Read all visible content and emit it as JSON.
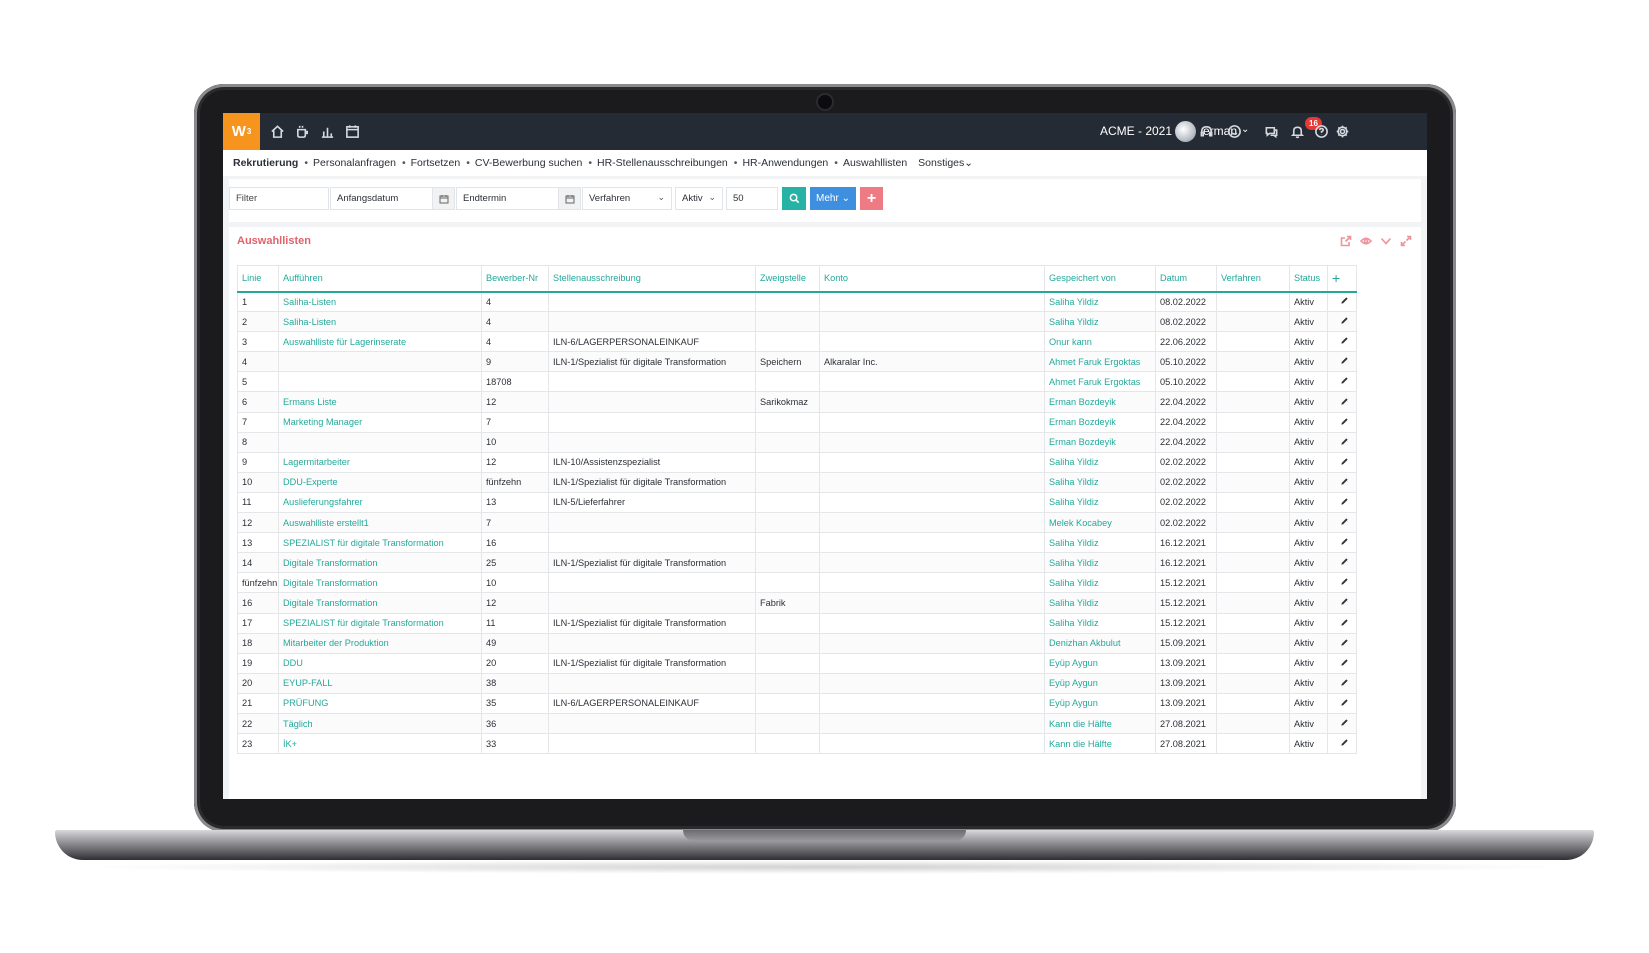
{
  "app": {
    "logo_text": "W",
    "logo_sup": "3",
    "company": "ACME - 2021",
    "username": "erman",
    "notification_count": "16",
    "brand_color": "#f7941d",
    "accent_color": "#23a99a"
  },
  "nav": {
    "items": [
      {
        "label": "Rekrutierung",
        "active": true
      },
      {
        "label": "Personalanfragen"
      },
      {
        "label": "Fortsetzen"
      },
      {
        "label": "CV-Bewerbung suchen"
      },
      {
        "label": "HR-Stellenausschreibungen"
      },
      {
        "label": "HR-Anwendungen"
      },
      {
        "label": "Auswahllisten"
      }
    ],
    "more_label": "Sonstiges"
  },
  "filters": {
    "filter_placeholder": "Filter",
    "start_date_placeholder": "Anfangsdatum",
    "end_date_placeholder": "Endtermin",
    "procedure_value": "Verfahren",
    "status_value": "Aktiv",
    "page_size_value": "50",
    "more_label": "Mehr"
  },
  "panel": {
    "title": "Auswahllisten"
  },
  "table": {
    "headers": [
      "Linie",
      "Aufführen",
      "Bewerber-Nr",
      "Stellenausschreibung",
      "Zweigstelle",
      "Konto",
      "Gespeichert von",
      "Datum",
      "Verfahren",
      "Status"
    ],
    "rows": [
      {
        "linie": "1",
        "name": "Saliha-Listen",
        "nr": "4",
        "stelle": "",
        "zweig": "",
        "konto": "",
        "von": "Saliha Yildiz",
        "datum": "08.02.2022",
        "verfahren": "",
        "status": "Aktiv"
      },
      {
        "linie": "2",
        "name": "Saliha-Listen",
        "nr": "4",
        "stelle": "",
        "zweig": "",
        "konto": "",
        "von": "Saliha Yildiz",
        "datum": "08.02.2022",
        "verfahren": "",
        "status": "Aktiv"
      },
      {
        "linie": "3",
        "name": "Auswahlliste für Lagerinserate",
        "nr": "4",
        "stelle": "ILN-6/LAGERPERSONALEINKAUF",
        "zweig": "",
        "konto": "",
        "von": "Onur kann",
        "datum": "22.06.2022",
        "verfahren": "",
        "status": "Aktiv"
      },
      {
        "linie": "4",
        "name": "",
        "nr": "9",
        "stelle": "ILN-1/Spezialist für digitale Transformation",
        "zweig": "Speichern",
        "konto": "Alkaralar Inc.",
        "von": "Ahmet Faruk Ergoktas",
        "datum": "05.10.2022",
        "verfahren": "",
        "status": "Aktiv"
      },
      {
        "linie": "5",
        "name": "",
        "nr": "18708",
        "stelle": "",
        "zweig": "",
        "konto": "",
        "von": "Ahmet Faruk Ergoktas",
        "datum": "05.10.2022",
        "verfahren": "",
        "status": "Aktiv"
      },
      {
        "linie": "6",
        "name": "Ermans Liste",
        "nr": "12",
        "stelle": "",
        "zweig": "Sarikokmaz",
        "konto": "",
        "von": "Erman Bozdeyik",
        "datum": "22.04.2022",
        "verfahren": "",
        "status": "Aktiv"
      },
      {
        "linie": "7",
        "name": "Marketing Manager",
        "nr": "7",
        "stelle": "",
        "zweig": "",
        "konto": "",
        "von": "Erman Bozdeyik",
        "datum": "22.04.2022",
        "verfahren": "",
        "status": "Aktiv"
      },
      {
        "linie": "8",
        "name": "",
        "nr": "10",
        "stelle": "",
        "zweig": "",
        "konto": "",
        "von": "Erman Bozdeyik",
        "datum": "22.04.2022",
        "verfahren": "",
        "status": "Aktiv"
      },
      {
        "linie": "9",
        "name": "Lagermitarbeiter",
        "nr": "12",
        "stelle": "ILN-10/Assistenzspezialist",
        "zweig": "",
        "konto": "",
        "von": "Saliha Yildiz",
        "datum": "02.02.2022",
        "verfahren": "",
        "status": "Aktiv"
      },
      {
        "linie": "10",
        "name": "DDU-Experte",
        "nr": "fünfzehn",
        "stelle": "ILN-1/Spezialist für digitale Transformation",
        "zweig": "",
        "konto": "",
        "von": "Saliha Yildiz",
        "datum": "02.02.2022",
        "verfahren": "",
        "status": "Aktiv"
      },
      {
        "linie": "11",
        "name": "Auslieferungsfahrer",
        "nr": "13",
        "stelle": "ILN-5/Lieferfahrer",
        "zweig": "",
        "konto": "",
        "von": "Saliha Yildiz",
        "datum": "02.02.2022",
        "verfahren": "",
        "status": "Aktiv"
      },
      {
        "linie": "12",
        "name": "Auswahlliste erstellt1",
        "nr": "7",
        "stelle": "",
        "zweig": "",
        "konto": "",
        "von": "Melek Kocabey",
        "datum": "02.02.2022",
        "verfahren": "",
        "status": "Aktiv"
      },
      {
        "linie": "13",
        "name": "SPEZIALIST für digitale Transformation",
        "nr": "16",
        "stelle": "",
        "zweig": "",
        "konto": "",
        "von": "Saliha Yildiz",
        "datum": "16.12.2021",
        "verfahren": "",
        "status": "Aktiv"
      },
      {
        "linie": "14",
        "name": "Digitale Transformation",
        "nr": "25",
        "stelle": "ILN-1/Spezialist für digitale Transformation",
        "zweig": "",
        "konto": "",
        "von": "Saliha Yildiz",
        "datum": "16.12.2021",
        "verfahren": "",
        "status": "Aktiv"
      },
      {
        "linie": "fünfzehn",
        "name": "Digitale Transformation",
        "nr": "10",
        "stelle": "",
        "zweig": "",
        "konto": "",
        "von": "Saliha Yildiz",
        "datum": "15.12.2021",
        "verfahren": "",
        "status": "Aktiv"
      },
      {
        "linie": "16",
        "name": "Digitale Transformation",
        "nr": "12",
        "stelle": "",
        "zweig": "Fabrik",
        "konto": "",
        "von": "Saliha Yildiz",
        "datum": "15.12.2021",
        "verfahren": "",
        "status": "Aktiv"
      },
      {
        "linie": "17",
        "name": "SPEZIALIST für digitale Transformation",
        "nr": "11",
        "stelle": "ILN-1/Spezialist für digitale Transformation",
        "zweig": "",
        "konto": "",
        "von": "Saliha Yildiz",
        "datum": "15.12.2021",
        "verfahren": "",
        "status": "Aktiv"
      },
      {
        "linie": "18",
        "name": "Mitarbeiter der Produktion",
        "nr": "49",
        "stelle": "",
        "zweig": "",
        "konto": "",
        "von": "Denizhan Akbulut",
        "datum": "15.09.2021",
        "verfahren": "",
        "status": "Aktiv"
      },
      {
        "linie": "19",
        "name": "DDU",
        "nr": "20",
        "stelle": "ILN-1/Spezialist für digitale Transformation",
        "zweig": "",
        "konto": "",
        "von": "Eyüp Aygun",
        "datum": "13.09.2021",
        "verfahren": "",
        "status": "Aktiv"
      },
      {
        "linie": "20",
        "name": "EYUP-FALL",
        "nr": "38",
        "stelle": "",
        "zweig": "",
        "konto": "",
        "von": "Eyüp Aygun",
        "datum": "13.09.2021",
        "verfahren": "",
        "status": "Aktiv"
      },
      {
        "linie": "21",
        "name": "PRÜFUNG",
        "nr": "35",
        "stelle": "ILN-6/LAGERPERSONALEINKAUF",
        "zweig": "",
        "konto": "",
        "von": "Eyüp Aygun",
        "datum": "13.09.2021",
        "verfahren": "",
        "status": "Aktiv"
      },
      {
        "linie": "22",
        "name": "Täglich",
        "nr": "36",
        "stelle": "",
        "zweig": "",
        "konto": "",
        "von": "Kann die Hälfte",
        "datum": "27.08.2021",
        "verfahren": "",
        "status": "Aktiv"
      },
      {
        "linie": "23",
        "name": "İK+",
        "nr": "33",
        "stelle": "",
        "zweig": "",
        "konto": "",
        "von": "Kann die Hälfte",
        "datum": "27.08.2021",
        "verfahren": "",
        "status": "Aktiv"
      }
    ]
  }
}
